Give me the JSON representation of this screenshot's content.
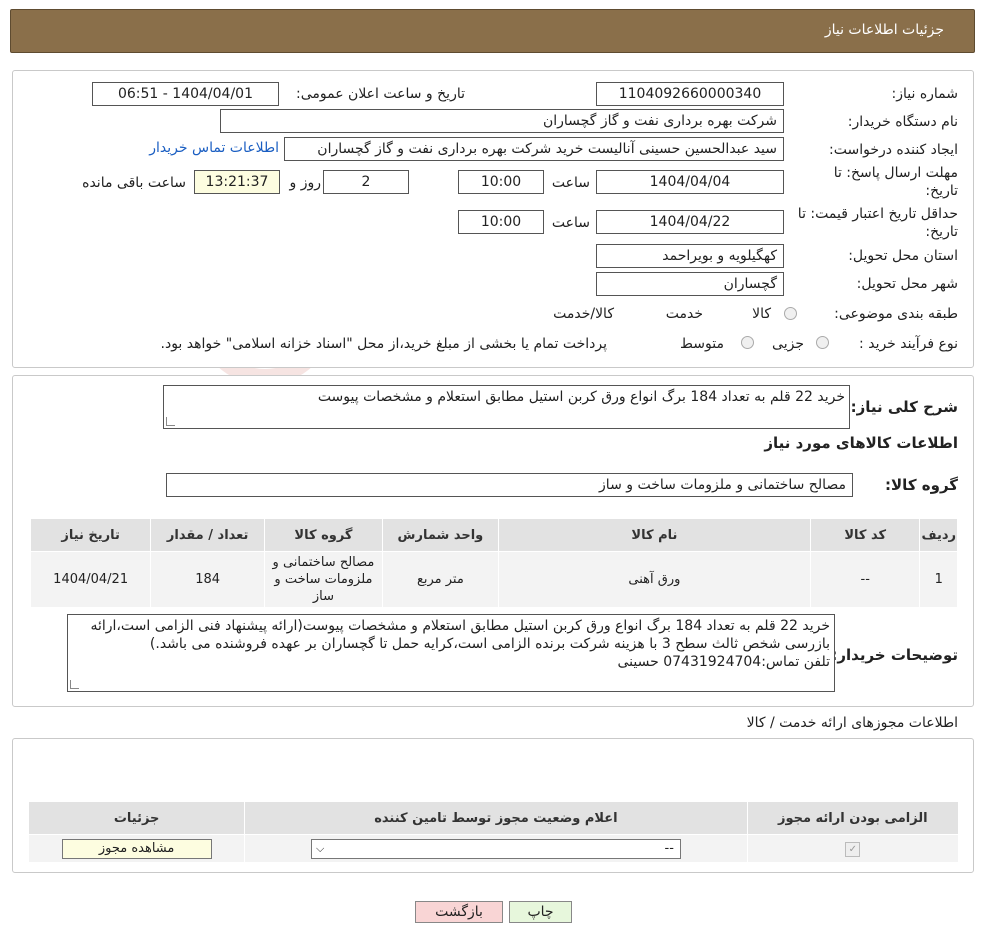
{
  "header": {
    "title": "جزئيات اطلاعات نياز"
  },
  "form": {
    "need_number_label": "شماره نیاز:",
    "need_number": "1104092660000340",
    "announce_label": "تاریخ و ساعت اعلان عمومی:",
    "announce_value": "1404/04/01 - 06:51",
    "buyer_org_label": "نام دستگاه خریدار:",
    "buyer_org": "شرکت بهره برداری نفت و گاز گچساران",
    "requester_label": "ایجاد کننده درخواست:",
    "requester": "سید عبدالحسین حسینی آنالیست خرید شرکت بهره برداری نفت و گاز گچساران",
    "contact_link": "اطلاعات تماس خریدار",
    "deadline_label_1": "مهلت ارسال پاسخ: تا",
    "deadline_label_2": "تاریخ:",
    "deadline_date": "1404/04/04",
    "time_label": "ساعت",
    "deadline_time": "10:00",
    "days_value": "2",
    "days_label": "روز و",
    "remaining_time": "13:21:37",
    "remaining_label": "ساعت باقی مانده",
    "price_validity_label_1": "حداقل تاریخ اعتبار قیمت: تا",
    "price_validity_label_2": "تاریخ:",
    "price_validity_date": "1404/04/22",
    "price_validity_time": "10:00",
    "province_label": "استان محل تحویل:",
    "province": "کهگیلویه و بویراحمد",
    "city_label": "شهر محل تحویل:",
    "city": "گچساران",
    "category_label": "طبقه بندی موضوعی:",
    "category_options": [
      "کالا",
      "خدمت",
      "کالا/خدمت"
    ],
    "process_label": "نوع فرآیند خرید :",
    "process_options": [
      "جزیی",
      "متوسط"
    ],
    "process_note": "پرداخت تمام یا بخشی از مبلغ خرید،از محل \"اسناد خزانه اسلامی\" خواهد بود."
  },
  "summary": {
    "desc_label": "شرح کلی نیاز:",
    "desc": "خرید 22 قلم به تعداد 184 برگ انواع ورق کربن استیل مطابق استعلام  و مشخصات پیوست",
    "goods_title": "اطلاعات کالاهای مورد نیاز",
    "group_label": "گروه کالا:",
    "group_value": "مصالح ساختمانی و ملزومات ساخت و ساز",
    "table_headers": [
      "ردیف",
      "کد کالا",
      "نام کالا",
      "واحد شمارش",
      "گروه کالا",
      "تعداد / مقدار",
      "تاریخ نیاز"
    ],
    "table_rows": [
      [
        "1",
        "--",
        "ورق آهنی",
        "متر مربع",
        "مصالح ساختمانی و ملزومات ساخت و ساز",
        "184",
        "1404/04/21"
      ]
    ],
    "buyer_notes_label": "توضیحات خریدار:",
    "buyer_notes": "خرید 22 قلم به تعداد 184 برگ انواع ورق کربن استیل مطابق استعلام  و مشخصات پیوست(ارائه پیشنهاد فنی الزامی است،ارائه بازرسی شخص ثالث سطح 3 با هزینه شرکت برنده الزامی است،کرایه حمل تا گچساران بر عهده فروشنده می باشد.)",
    "buyer_phone": "تلفن تماس:07431924704  حسینی"
  },
  "permits": {
    "title": "اطلاعات مجوزهای ارائه خدمت / کالا",
    "headers": [
      "الزامی بودن ارائه مجوز",
      "اعلام وضعیت مجوز توسط تامین کننده",
      "جزئیات"
    ],
    "select_value": "--",
    "view_button": "مشاهده مجوز"
  },
  "footer": {
    "print_button": "چاپ",
    "back_button": "بازگشت"
  },
  "watermark": {
    "text": "AriaTender.neT"
  },
  "colors": {
    "header_bg": "#8a6f4a",
    "link": "#1a5ec2",
    "back_btn_bg": "#f9d5d5",
    "print_btn_bg": "#e7f7dc"
  }
}
